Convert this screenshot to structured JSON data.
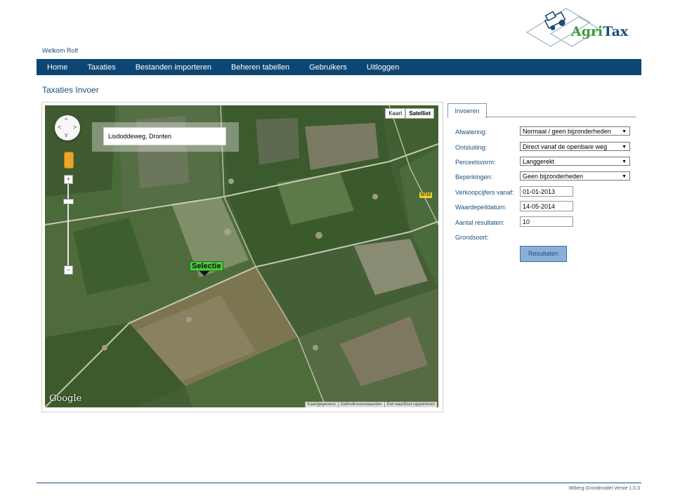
{
  "brand": {
    "agri": "Agri",
    "tax": "Tax",
    "agri_color": "#3a9b3c",
    "tax_color": "#1c4e79"
  },
  "welcome": "Welkom Rolf",
  "nav": {
    "items": [
      {
        "label": "Home"
      },
      {
        "label": "Taxaties"
      },
      {
        "label": "Bestanden importeren"
      },
      {
        "label": "Beheren tabellen"
      },
      {
        "label": "Gebruikers"
      },
      {
        "label": "Uitloggen"
      }
    ],
    "bg_color": "#0d4673"
  },
  "page_title": "Taxaties Invoer",
  "map": {
    "search_value": "Lisdoddeweg, Dronten",
    "map_type": {
      "kaart": "Kaart",
      "satelliet": "Satelliet"
    },
    "road_badge": "N710",
    "marker_label": "Selectie",
    "google": "Google",
    "attribution": [
      "Kaartgegevens",
      "Gebruiksvoorwaarden",
      "Een kaartfout rapporteren"
    ],
    "zoom_plus": "+",
    "zoom_minus": "−"
  },
  "form": {
    "tab": "Invoeren",
    "afwatering": {
      "label": "Afwatering:",
      "value": "Normaal / geen bijzonderheden"
    },
    "ontsluiting": {
      "label": "Ontsluiting:",
      "value": "Direct vanaf de openbare weg"
    },
    "perceelsvorm": {
      "label": "Perceelsvorm:",
      "value": "Langgerekt"
    },
    "beperkingen": {
      "label": "Beperkingen:",
      "value": "Geen bijzonderheden"
    },
    "verkoopcijfers": {
      "label": "Verkoopcijfers vanaf:",
      "value": "01-01-2013"
    },
    "waardepeildatum": {
      "label": "Waardepeildatum:",
      "value": "14-05-2014"
    },
    "aantal": {
      "label": "Aantal resultaten:",
      "value": "10"
    },
    "grondsoort": {
      "label": "Grondsoort:"
    },
    "button": "Resultaten",
    "select_arrow": "▼"
  },
  "footer": "Wiberg Grondmodel Versie 1.0.3"
}
